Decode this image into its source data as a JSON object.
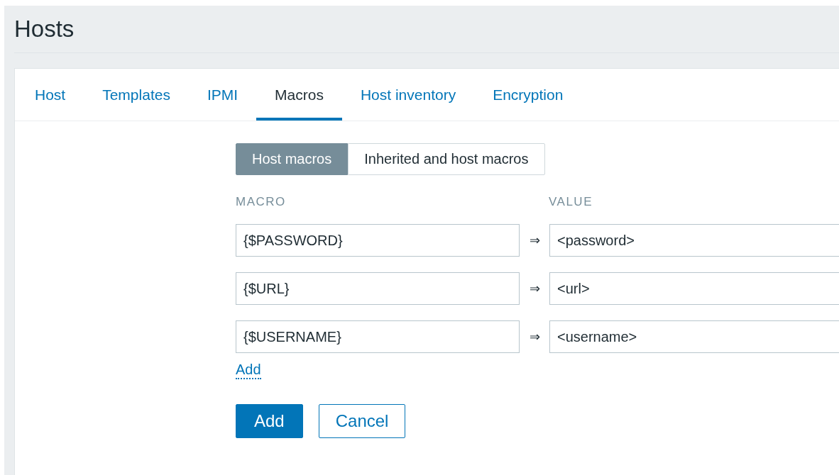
{
  "page": {
    "title": "Hosts"
  },
  "tabs": [
    {
      "label": "Host",
      "selected": false
    },
    {
      "label": "Templates",
      "selected": false
    },
    {
      "label": "IPMI",
      "selected": false
    },
    {
      "label": "Macros",
      "selected": true
    },
    {
      "label": "Host inventory",
      "selected": false
    },
    {
      "label": "Encryption",
      "selected": false
    }
  ],
  "macro_mode": [
    {
      "label": "Host macros",
      "selected": true
    },
    {
      "label": "Inherited and host macros",
      "selected": false
    }
  ],
  "columns": [
    "MACRO",
    "VALUE"
  ],
  "macros": [
    {
      "macro": "{$PASSWORD}",
      "arrow": "⇒",
      "value": "<password>"
    },
    {
      "macro": "{$URL}",
      "arrow": "⇒",
      "value": "<url>"
    },
    {
      "macro": "{$USERNAME}",
      "arrow": "⇒",
      "value": "<username>"
    }
  ],
  "add_link": "Add",
  "buttons": [
    {
      "label": "Add",
      "kind": "primary"
    },
    {
      "label": "Cancel",
      "kind": "secondary"
    }
  ]
}
